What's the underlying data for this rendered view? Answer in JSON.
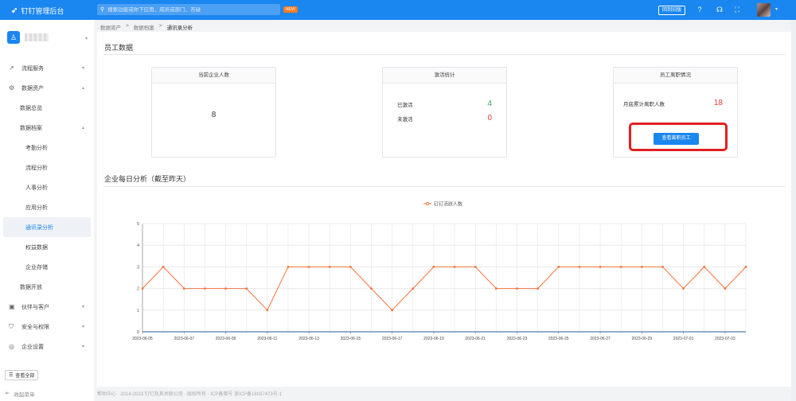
{
  "topbar": {
    "brand": "钉钉管理后台",
    "search_placeholder": "搜索功能或你下应用、成员或部门、答疑",
    "new_badge": "NEW",
    "action_button": "回到旧版"
  },
  "sidebar": {
    "nav": [
      {
        "label": "流程服务",
        "level": 1,
        "icon": "trend-icon",
        "caret": "▾"
      },
      {
        "label": "数据资产",
        "level": 1,
        "icon": "gear-icon",
        "caret": "▴"
      },
      {
        "label": "数据总览",
        "level": 2
      },
      {
        "label": "数据档案",
        "level": 2,
        "caret": "▴"
      },
      {
        "label": "考勤分析",
        "level": 3
      },
      {
        "label": "流程分析",
        "level": 3
      },
      {
        "label": "人事分析",
        "level": 3
      },
      {
        "label": "应用分析",
        "level": 3
      },
      {
        "label": "通讯录分析",
        "level": 3,
        "active": true
      },
      {
        "label": "权益数据",
        "level": 3
      },
      {
        "label": "企业存储",
        "level": 3
      },
      {
        "label": "数据开放",
        "level": 2
      },
      {
        "label": "伙伴与客户",
        "level": 1,
        "icon": "building-icon",
        "caret": "▾"
      },
      {
        "label": "安全与权限",
        "level": 1,
        "icon": "shield-icon",
        "caret": "▾"
      },
      {
        "label": "企业设置",
        "level": 1,
        "icon": "settings-icon",
        "caret": "▾"
      }
    ],
    "all_button": "查看全部",
    "collapse": "收起菜单"
  },
  "breadcrumb": {
    "items": [
      "数据资产",
      "数据档案",
      "通讯录分析"
    ],
    "sep": ">"
  },
  "main": {
    "section_title": "员工数据",
    "card1": {
      "title": "当前企业人数",
      "value": "8"
    },
    "card2": {
      "title": "激活统计",
      "activated_label": "已激活",
      "activated_value": "4",
      "inactive_label": "未激活",
      "inactive_value": "0"
    },
    "card3": {
      "title": "员工离职情况",
      "label": "月底累计离职人数",
      "value": "18",
      "button": "查看离职员工"
    },
    "chart_title": "企业每日分析（截至昨天）"
  },
  "footer": "帮助中心 · 2014-2023 钉钉及其关联公司 · 版权所有 · ICP备案号 浙ICP备18037473号-1",
  "chart_data": {
    "type": "line",
    "legend": [
      "钉钉活跃人数"
    ],
    "legend_position": "top-center",
    "color": "#f5743e",
    "ylim": [
      0,
      5
    ],
    "yticks": [
      0,
      1,
      2,
      3,
      4,
      5
    ],
    "grid": true,
    "x": [
      "2023-06-05",
      "2023-06-06",
      "2023-06-07",
      "2023-06-08",
      "2023-06-09",
      "2023-06-10",
      "2023-06-11",
      "2023-06-12",
      "2023-06-13",
      "2023-06-14",
      "2023-06-15",
      "2023-06-16",
      "2023-06-17",
      "2023-06-18",
      "2023-06-19",
      "2023-06-20",
      "2023-06-21",
      "2023-06-22",
      "2023-06-23",
      "2023-06-24",
      "2023-06-25",
      "2023-06-26",
      "2023-06-27",
      "2023-06-28",
      "2023-06-29",
      "2023-06-30",
      "2023-07-01",
      "2023-07-02",
      "2023-07-03",
      "2023-07-04"
    ],
    "xtick_labels": [
      "2023-06-05",
      "2023-06-07",
      "2023-06-09",
      "2023-06-11",
      "2023-06-13",
      "2023-06-15",
      "2023-06-17",
      "2023-06-19",
      "2023-06-21",
      "2023-06-23",
      "2023-06-25",
      "2023-06-27",
      "2023-06-29",
      "2023-07-01",
      "2023-07-03"
    ],
    "series": [
      {
        "name": "钉钉活跃人数",
        "values": [
          2,
          3,
          2,
          2,
          2,
          2,
          1,
          3,
          3,
          3,
          3,
          2,
          1,
          2,
          3,
          3,
          3,
          2,
          2,
          2,
          3,
          3,
          3,
          3,
          3,
          3,
          2,
          3,
          2,
          3
        ]
      }
    ]
  }
}
